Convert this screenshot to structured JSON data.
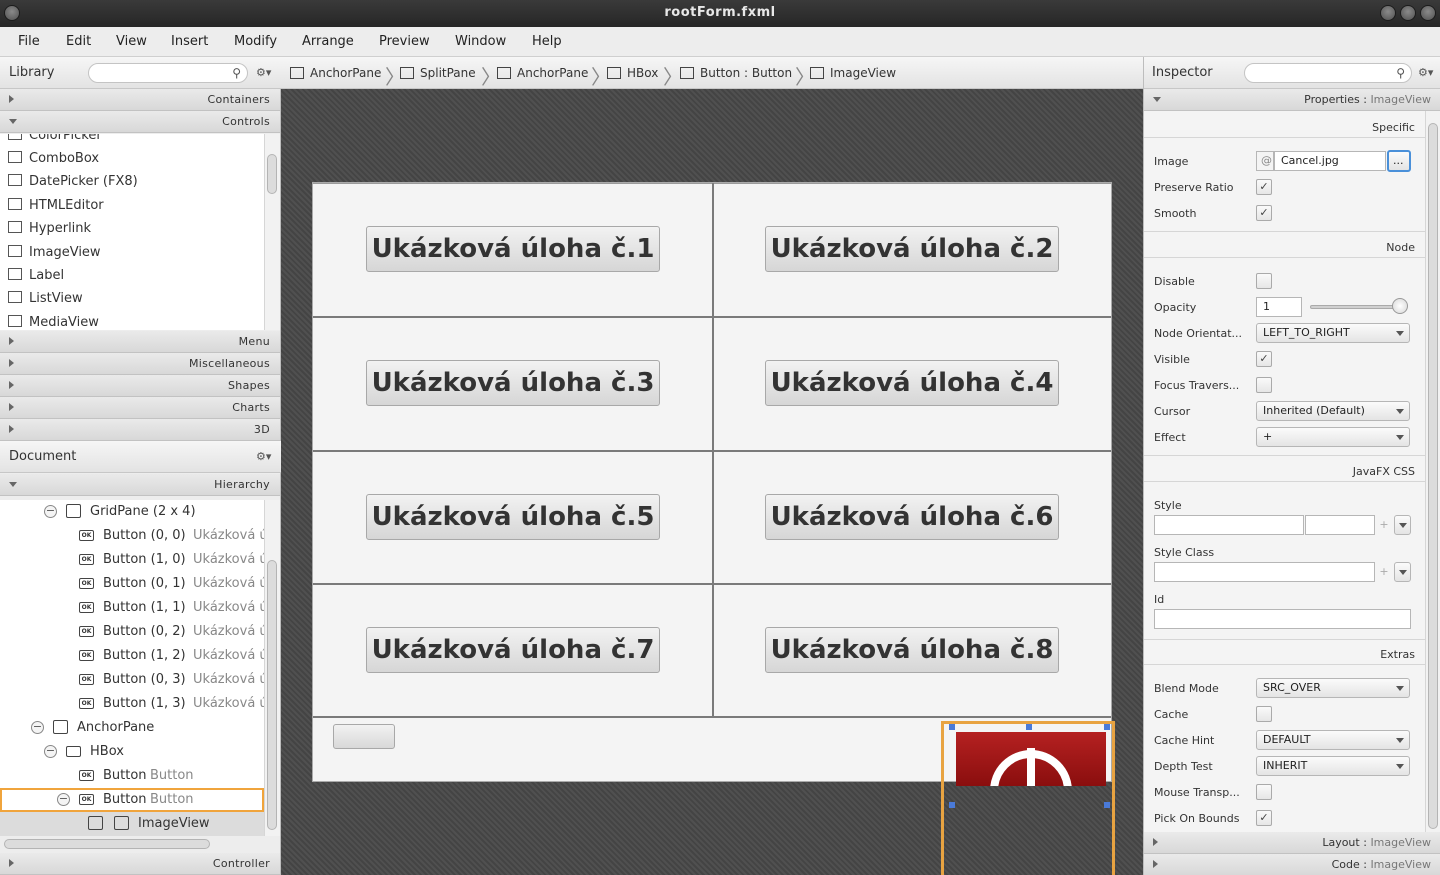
{
  "window": {
    "title": "rootForm.fxml"
  },
  "menu": [
    "File",
    "Edit",
    "View",
    "Insert",
    "Modify",
    "Arrange",
    "Preview",
    "Window",
    "Help"
  ],
  "library": {
    "title": "Library",
    "search_placeholder": "",
    "sections_top": [
      "Containers",
      "Controls"
    ],
    "items": [
      "ColorPicker",
      "ComboBox",
      "DatePicker  (FX8)",
      "HTMLEditor",
      "Hyperlink",
      "ImageView",
      "Label",
      "ListView",
      "MediaView"
    ],
    "sections_bottom": [
      "Menu",
      "Miscellaneous",
      "Shapes",
      "Charts",
      "3D"
    ]
  },
  "document": {
    "title": "Document",
    "section": "Hierarchy",
    "footer": "Controller",
    "rows": [
      {
        "name": "GridPane (2 x 4)",
        "sub": ""
      },
      {
        "name": "Button (0, 0)",
        "sub": "Ukázková ú"
      },
      {
        "name": "Button (1, 0)",
        "sub": "Ukázková ú"
      },
      {
        "name": "Button (0, 1)",
        "sub": "Ukázková ú"
      },
      {
        "name": "Button (1, 1)",
        "sub": "Ukázková ú"
      },
      {
        "name": "Button (0, 2)",
        "sub": "Ukázková ú"
      },
      {
        "name": "Button (1, 2)",
        "sub": "Ukázková ú"
      },
      {
        "name": "Button (0, 3)",
        "sub": "Ukázková ú"
      },
      {
        "name": "Button (1, 3)",
        "sub": "Ukázková ú"
      },
      {
        "name": "AnchorPane",
        "sub": ""
      },
      {
        "name": "HBox",
        "sub": ""
      },
      {
        "name": "Button",
        "sub": "Button"
      },
      {
        "name": "Button",
        "sub": "Button"
      },
      {
        "name": "ImageView",
        "sub": ""
      }
    ]
  },
  "breadcrumb": [
    "AnchorPane",
    "SplitPane",
    "AnchorPane",
    "HBox",
    "Button : Button",
    "ImageView"
  ],
  "canvas": {
    "buttons": [
      "Ukázková úloha č.1",
      "Ukázková úloha č.2",
      "Ukázková úloha č.3",
      "Ukázková úloha č.4",
      "Ukázková úloha č.5",
      "Ukázková úloha č.6",
      "Ukázková úloha č.7",
      "Ukázková úloha č.8"
    ]
  },
  "inspector": {
    "title": "Inspector",
    "properties_label": "Properties",
    "properties_target": "ImageView",
    "specific_label": "Specific",
    "image_label": "Image",
    "image_value": "Cancel.jpg",
    "image_at": "@",
    "browse": "...",
    "preserve_ratio": "Preserve Ratio",
    "smooth": "Smooth",
    "node_label": "Node",
    "disable": "Disable",
    "opacity": "Opacity",
    "opacity_value": "1",
    "node_orientation": "Node Orientat...",
    "node_orientation_value": "LEFT_TO_RIGHT",
    "visible": "Visible",
    "focus_traversable": "Focus Travers...",
    "cursor": "Cursor",
    "cursor_value": "Inherited (Default)",
    "effect": "Effect",
    "effect_value": "+",
    "css_label": "JavaFX CSS",
    "style": "Style",
    "style_class": "Style Class",
    "id": "Id",
    "plus": "+",
    "extras_label": "Extras",
    "blend_mode": "Blend Mode",
    "blend_mode_value": "SRC_OVER",
    "cache": "Cache",
    "cache_hint": "Cache Hint",
    "cache_hint_value": "DEFAULT",
    "depth_test": "Depth Test",
    "depth_test_value": "INHERIT",
    "mouse_transparent": "Mouse Transp...",
    "pick_on_bounds": "Pick On Bounds",
    "layout_label": "Layout",
    "code_label": "Code",
    "check": "✓"
  },
  "icons": {
    "search": "⚲",
    "gear": "⚙▾",
    "collapse": "−",
    "ok": "OK"
  },
  "colors": {
    "selection_outline": "#f0a43c",
    "title_bar": "#2e2e2e",
    "canvas_bg": "#4a4a4a"
  }
}
